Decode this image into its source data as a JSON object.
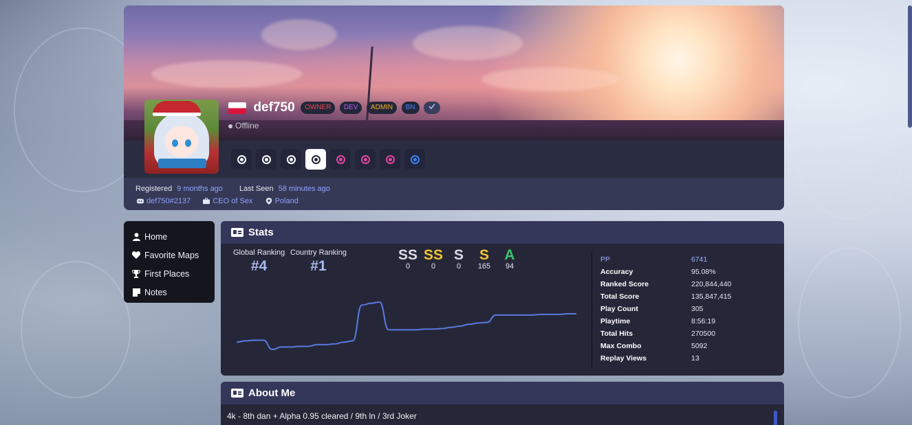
{
  "profile": {
    "username": "def750",
    "status": "Offline",
    "badges": [
      {
        "label": "OWNER",
        "color": "#e04a4a"
      },
      {
        "label": "DEV",
        "color": "#b45cf0"
      },
      {
        "label": "ADMIN",
        "color": "#f0b429"
      },
      {
        "label": "BN",
        "color": "#4f86f7"
      }
    ],
    "verified_icon": "check-icon",
    "flag": "poland-flag-icon"
  },
  "modes": [
    {
      "name": "osu-standard",
      "color": "#ffffff",
      "active": false
    },
    {
      "name": "osu-taiko",
      "color": "#ffffff",
      "active": false
    },
    {
      "name": "osu-catch",
      "color": "#ffffff",
      "active": false
    },
    {
      "name": "osu-mania",
      "color": "#23253a",
      "active": true
    },
    {
      "name": "relax-standard",
      "color": "#e0479e",
      "active": false
    },
    {
      "name": "relax-taiko",
      "color": "#e0479e",
      "active": false
    },
    {
      "name": "relax-catch",
      "color": "#e0479e",
      "active": false
    },
    {
      "name": "autopilot-standard",
      "color": "#3b82f6",
      "active": false
    }
  ],
  "info": {
    "registered_label": "Registered",
    "registered_value": "9 months ago",
    "last_seen_label": "Last Seen",
    "last_seen_value": "58 minutes ago",
    "discord": "def750#2137",
    "title": "CEO of Sex",
    "location": "Poland"
  },
  "sidebar": {
    "items": [
      {
        "label": "Home",
        "icon": "user-icon"
      },
      {
        "label": "Favorite Maps",
        "icon": "heart-icon"
      },
      {
        "label": "First Places",
        "icon": "trophy-icon"
      },
      {
        "label": "Notes",
        "icon": "note-icon"
      }
    ]
  },
  "stats": {
    "heading": "Stats",
    "global_ranking_label": "Global Ranking",
    "global_ranking_value": "#4",
    "country_ranking_label": "Country Ranking",
    "country_ranking_value": "#1",
    "grades": [
      {
        "label": "SS",
        "count": "0",
        "color": "#d9dbe6"
      },
      {
        "label": "SS",
        "count": "0",
        "color": "#f2c230"
      },
      {
        "label": "S",
        "count": "0",
        "color": "#d9dbe6"
      },
      {
        "label": "S",
        "count": "165",
        "color": "#f2c230"
      },
      {
        "label": "A",
        "count": "94",
        "color": "#3bc46a"
      }
    ],
    "rows": [
      {
        "key": "PP",
        "value": "6741"
      },
      {
        "key": "Accuracy",
        "value": "95.08%"
      },
      {
        "key": "Ranked Score",
        "value": "220,844,440"
      },
      {
        "key": "Total Score",
        "value": "135,847,415"
      },
      {
        "key": "Play Count",
        "value": "305"
      },
      {
        "key": "Playtime",
        "value": "8:56:19"
      },
      {
        "key": "Total Hits",
        "value": "270500"
      },
      {
        "key": "Max Combo",
        "value": "5092"
      },
      {
        "key": "Replay Views",
        "value": "13"
      }
    ]
  },
  "chart_data": {
    "type": "line",
    "series": [
      {
        "values": [
          60,
          58,
          57,
          57,
          72,
          68,
          68,
          67,
          67,
          64,
          64,
          63,
          60,
          58,
          0,
          -3,
          -5,
          40,
          40,
          40,
          40,
          39,
          39,
          38,
          36,
          34,
          31,
          29,
          28,
          16,
          16,
          16,
          16,
          16,
          15,
          15,
          15,
          14,
          14
        ]
      }
    ],
    "color": "#5a78e0",
    "note_direction": "values are rank positions; lower is better"
  },
  "about": {
    "heading": "About Me",
    "text": "4k - 8th dan + Alpha 0.95 cleared / 9th ln / 3rd Joker"
  }
}
